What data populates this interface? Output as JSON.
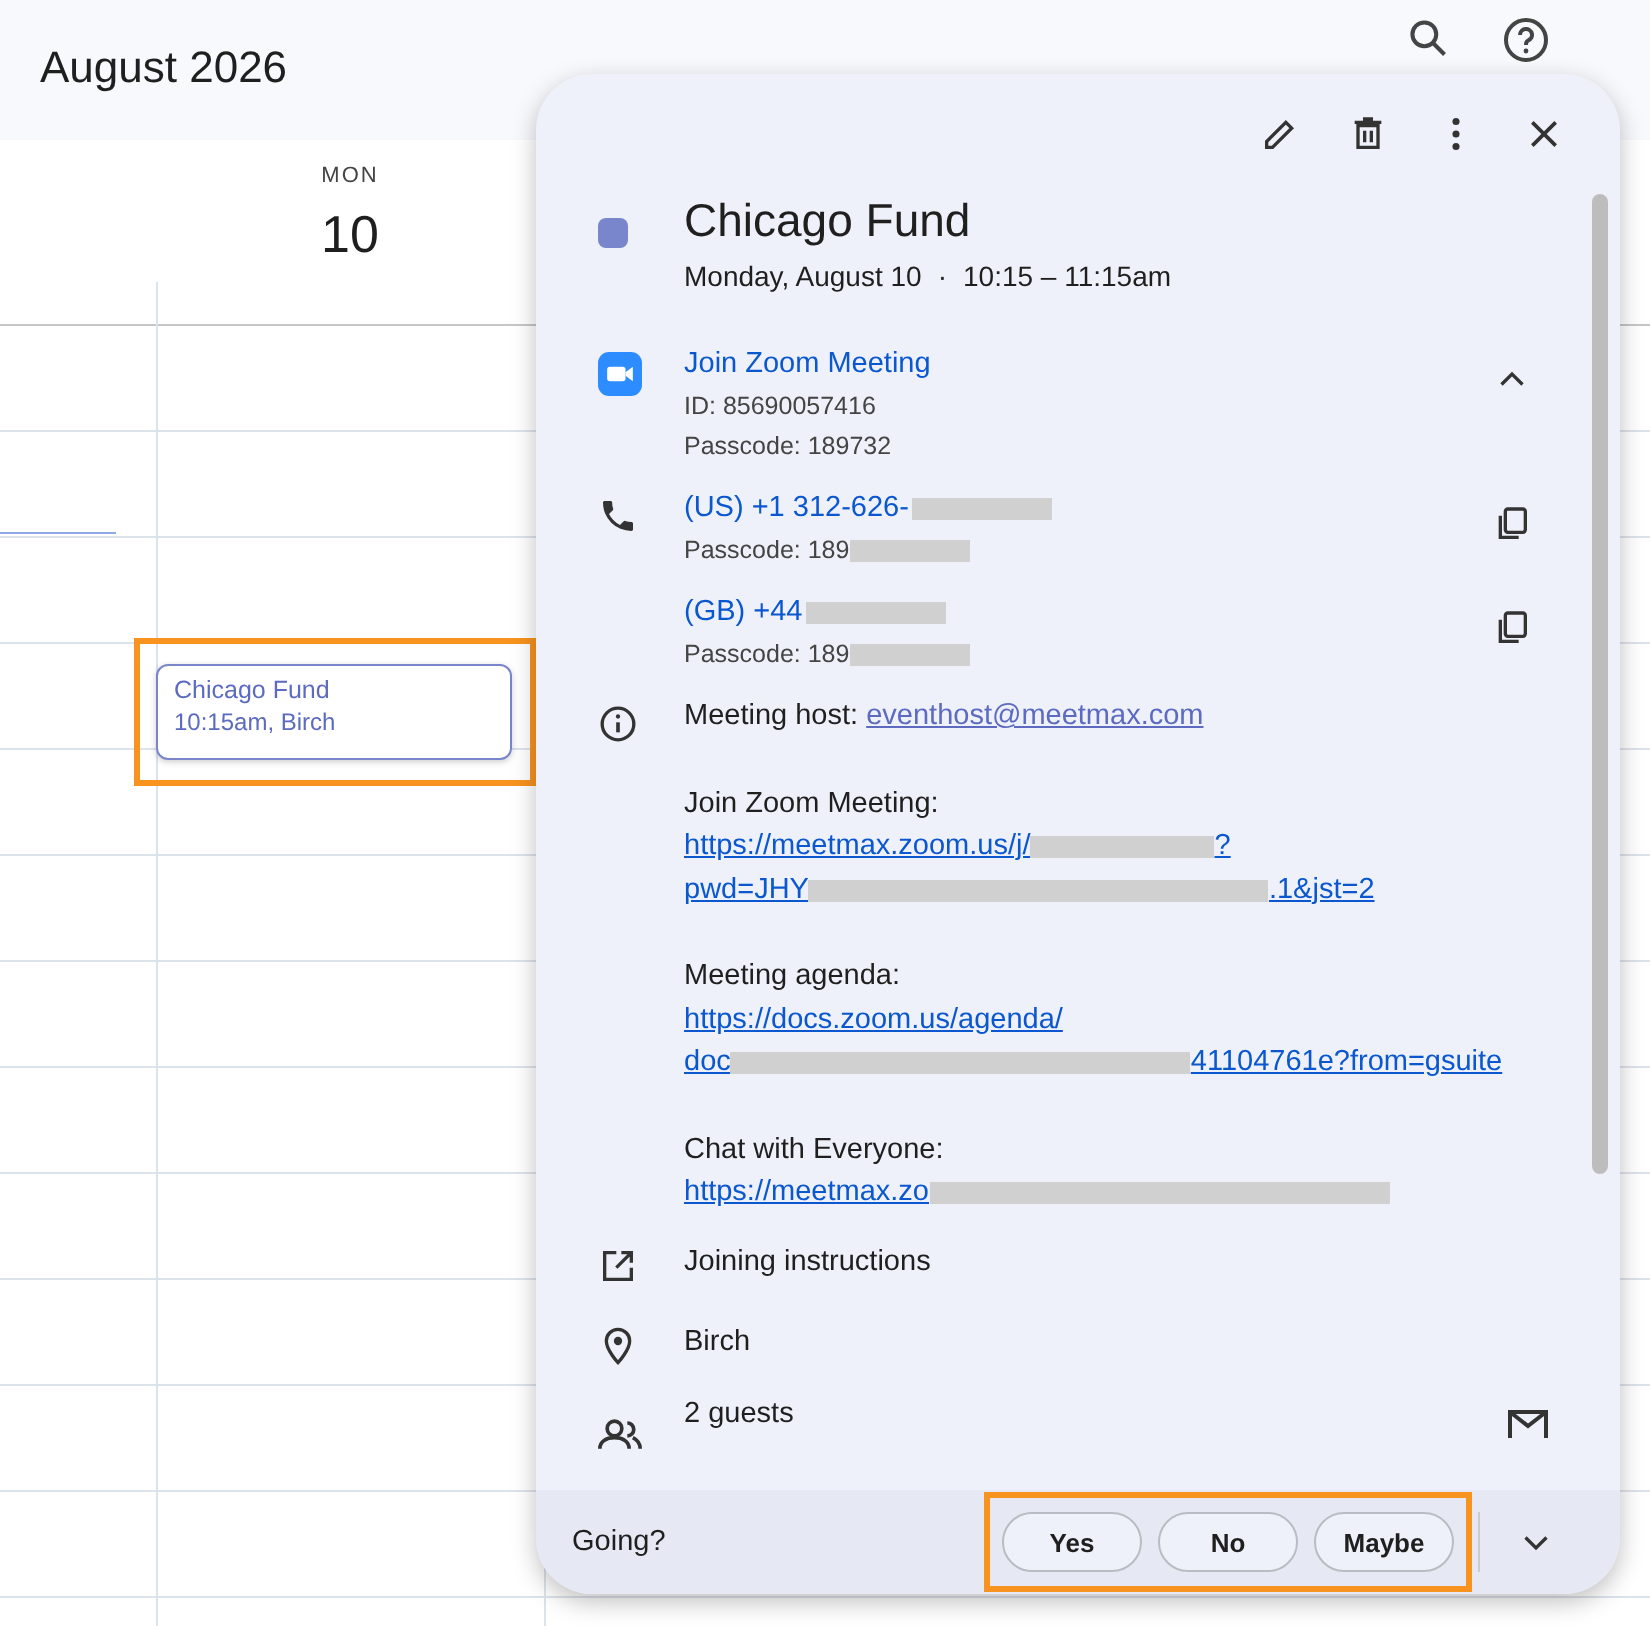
{
  "header": {
    "title": "August 2026"
  },
  "day": {
    "weekday": "MON",
    "date": "10"
  },
  "event_chip": {
    "title": "Chicago Fund",
    "subtitle": "10:15am, Birch",
    "highlighted": true
  },
  "popup": {
    "title": "Chicago Fund",
    "color": "#7986cb",
    "date": "Monday, August 10",
    "separator": "·",
    "time": "10:15 – 11:15am",
    "conference": {
      "title": "Join Zoom Meeting",
      "id": "ID: 85690057416",
      "passcode": "Passcode: 189732",
      "expanded": true
    },
    "phones": [
      {
        "number": "(US) +1 312-626-",
        "passcode": "Passcode: 189"
      },
      {
        "number": "(GB) +44",
        "passcode": "Passcode: 189"
      }
    ],
    "host_label": "Meeting host:",
    "host_email": "eventhost@meetmax.com",
    "description": [
      {
        "label": "Join Zoom Meeting:",
        "lines": [
          [
            {
              "kind": "text",
              "text": "https://meetmax.zoom.us/j/"
            },
            {
              "kind": "redacted-short"
            },
            {
              "kind": "text",
              "text": "?"
            }
          ],
          [
            {
              "kind": "text",
              "text": "pwd=JHY"
            },
            {
              "kind": "redacted-long"
            },
            {
              "kind": "text",
              "text": ".1&jst=2"
            }
          ]
        ]
      },
      {
        "label": "Meeting agenda:",
        "lines": [
          [
            {
              "kind": "text",
              "text": "https://docs.zoom.us/agenda/"
            }
          ],
          [
            {
              "kind": "text",
              "text": "doc"
            },
            {
              "kind": "redacted-long"
            },
            {
              "kind": "text",
              "text": "41104761e?from=gsuite"
            }
          ]
        ]
      },
      {
        "label": "Chat with Everyone:",
        "lines": [
          [
            {
              "kind": "text",
              "text": "https://meetmax.zo"
            },
            {
              "kind": "redacted-long"
            }
          ]
        ]
      }
    ],
    "joining": "Joining instructions",
    "location": "Birch",
    "guests": "2 guests",
    "footer": {
      "label": "Going?",
      "options": [
        {
          "label": "Yes",
          "selected": false
        },
        {
          "label": "No",
          "selected": false
        },
        {
          "label": "Maybe",
          "selected": false
        }
      ],
      "highlighted": true
    }
  }
}
